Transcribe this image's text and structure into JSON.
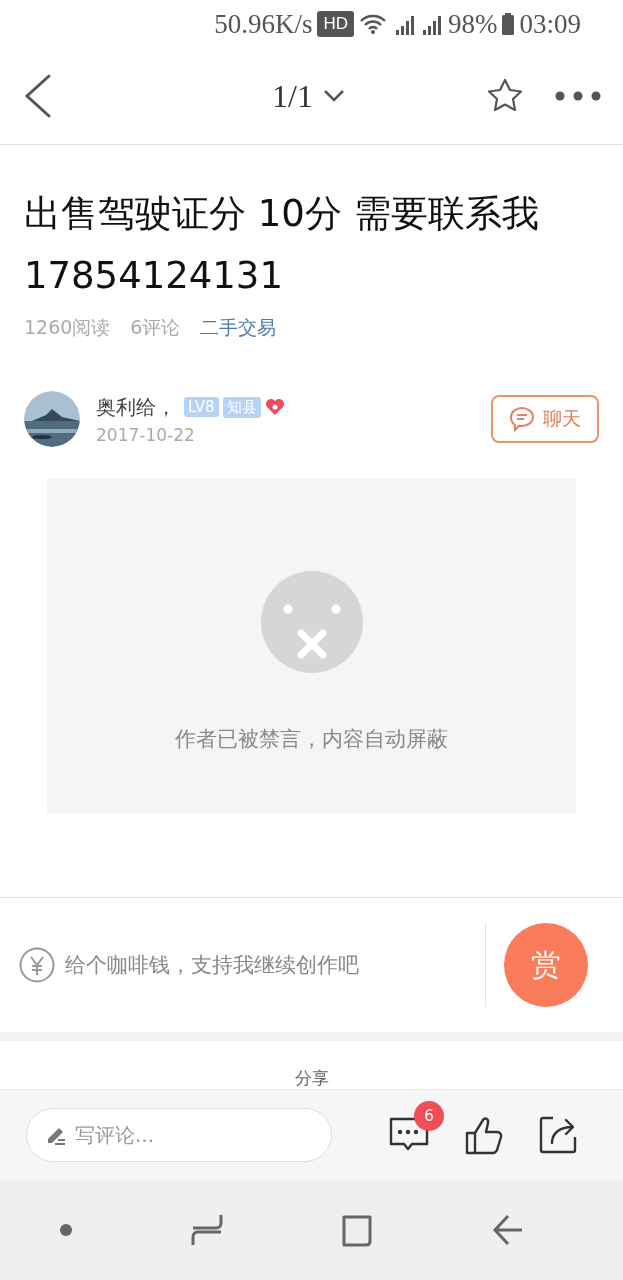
{
  "status_bar": {
    "speed": "50.96K/s",
    "hd": "HD",
    "battery": "98%",
    "time": "03:09"
  },
  "header": {
    "page": "1/1"
  },
  "article": {
    "title": "出售驾驶证分 10分 需要联系我17854124131",
    "reads": "1260阅读",
    "comments": "6评论",
    "category": "二手交易"
  },
  "author": {
    "name": "奥利给，",
    "level": "LV8",
    "rank": "知县",
    "date": "2017-10-22",
    "chat": "聊天"
  },
  "content": {
    "notice": "作者已被禁言，内容自动屏蔽"
  },
  "reward": {
    "text": "给个咖啡钱，支持我继续创作吧",
    "button": "赏"
  },
  "share": {
    "label": "分享"
  },
  "bottom_bar": {
    "placeholder": "写评论...",
    "comment_count": "6"
  }
}
